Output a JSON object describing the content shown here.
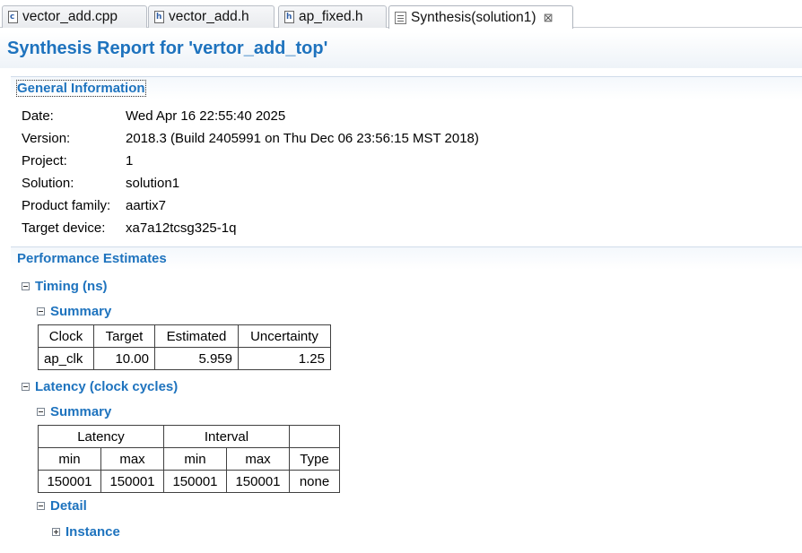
{
  "tabs": [
    {
      "label": "vector_add.cpp",
      "icon": "cpp-file-icon"
    },
    {
      "label": "vector_add.h",
      "icon": "header-file-icon"
    },
    {
      "label": "ap_fixed.h",
      "icon": "header-file-icon"
    },
    {
      "label": "Synthesis(solution1)",
      "icon": "report-icon",
      "close": "⊠"
    }
  ],
  "report_title": "Synthesis Report for 'vertor_add_top'",
  "general": {
    "header": "General Information",
    "rows": [
      {
        "label": "Date:",
        "value": "Wed Apr 16 22:55:40 2025"
      },
      {
        "label": "Version:",
        "value": "2018.3 (Build 2405991 on Thu Dec 06 23:56:15 MST 2018)"
      },
      {
        "label": "Project:",
        "value": "1"
      },
      {
        "label": "Solution:",
        "value": "solution1"
      },
      {
        "label": "Product family:",
        "value": "aartix7"
      },
      {
        "label": "Target device:",
        "value": "xa7a12tcsg325-1q"
      }
    ]
  },
  "performance": {
    "header": "Performance Estimates",
    "timing": {
      "header": "Timing (ns)",
      "summary": "Summary",
      "columns": [
        "Clock",
        "Target",
        "Estimated",
        "Uncertainty"
      ],
      "rows": [
        [
          "ap_clk",
          "10.00",
          "5.959",
          "1.25"
        ]
      ]
    },
    "latency": {
      "header": "Latency (clock cycles)",
      "summary": "Summary",
      "group_headers": [
        "Latency",
        "Interval",
        ""
      ],
      "columns": [
        "min",
        "max",
        "min",
        "max",
        "Type"
      ],
      "rows": [
        [
          "150001",
          "150001",
          "150001",
          "150001",
          "none"
        ]
      ],
      "detail": "Detail",
      "instance": "Instance"
    }
  },
  "colors": {
    "accent": "#1e73be",
    "border": "#404040"
  }
}
